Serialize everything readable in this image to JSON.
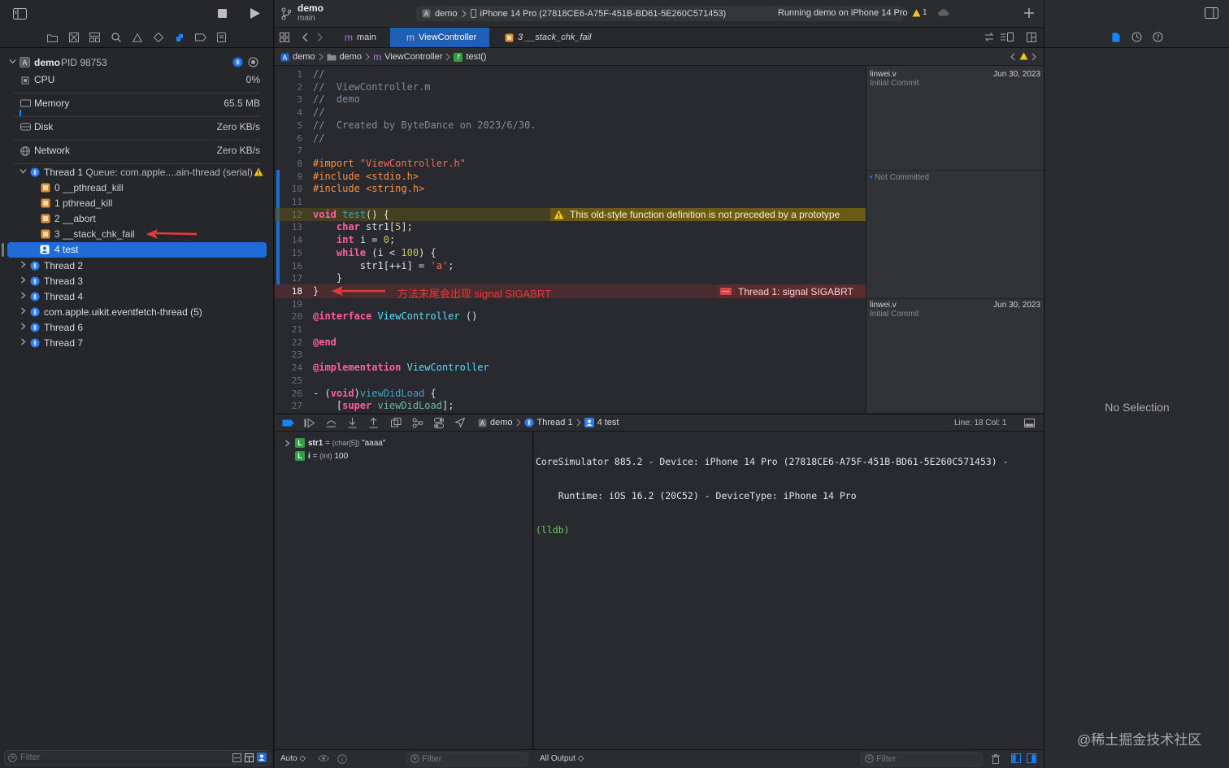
{
  "toolbar": {
    "project": "demo",
    "branch": "main",
    "scheme": "demo",
    "destination": "iPhone 14 Pro (27818CE6-A75F-451B-BD61-5E260C571453)",
    "status": "Running demo on iPhone 14 Pro",
    "warning_count": "1"
  },
  "navigator": {
    "process": {
      "name": "demo",
      "pid": "PID 98753"
    },
    "gauges": [
      {
        "label": "CPU",
        "value": "0%"
      },
      {
        "label": "Memory",
        "value": "65.5 MB"
      },
      {
        "label": "Disk",
        "value": "Zero KB/s"
      },
      {
        "label": "Network",
        "value": "Zero KB/s"
      }
    ],
    "thread1": {
      "label": "Thread 1",
      "queue": "Queue: com.apple....ain-thread (serial)"
    },
    "frames": [
      "0 __pthread_kill",
      "1 pthread_kill",
      "2 __abort",
      "3 __stack_chk_fail",
      "4 test"
    ],
    "threads": [
      "Thread 2",
      "Thread 3",
      "Thread 4",
      "com.apple.uikit.eventfetch-thread (5)",
      "Thread 6",
      "Thread 7"
    ],
    "filter_placeholder": "Filter"
  },
  "tabs": [
    {
      "prefix": "m",
      "label": "main"
    },
    {
      "prefix": "m",
      "label": "ViewController"
    },
    {
      "prefix": "",
      "label": "3 __stack_chk_fail"
    }
  ],
  "jumpbar": [
    "demo",
    "demo",
    "ViewController",
    "test()"
  ],
  "jumpbar_prefix": "m",
  "jumpbar_func_badge": "f",
  "editor": {
    "lines": [
      {
        "n": "1",
        "html": "<span class='cm'>//</span>"
      },
      {
        "n": "2",
        "html": "<span class='cm'>//  ViewController.m</span>"
      },
      {
        "n": "3",
        "html": "<span class='cm'>//  demo</span>"
      },
      {
        "n": "4",
        "html": "<span class='cm'>//</span>"
      },
      {
        "n": "5",
        "html": "<span class='cm'>//  Created by ByteDance on 2023/6/30.</span>"
      },
      {
        "n": "6",
        "html": "<span class='cm'>//</span>"
      },
      {
        "n": "7",
        "html": ""
      },
      {
        "n": "8",
        "html": "<span class='pp'>#import </span><span class='str'>\"ViewController.h\"</span>"
      },
      {
        "n": "9",
        "html": "<span class='pp'>#include &lt;stdio.h&gt;</span>"
      },
      {
        "n": "10",
        "html": "<span class='pp'>#include &lt;string.h&gt;</span>"
      },
      {
        "n": "11",
        "html": ""
      },
      {
        "n": "12",
        "html": "<span class='kw'>void</span> <span class='fnname'>test</span>() {"
      },
      {
        "n": "13",
        "html": "    <span class='kw'>char</span> str1[<span class='num'>5</span>];"
      },
      {
        "n": "14",
        "html": "    <span class='kw'>int</span> i = <span class='num'>0</span>;"
      },
      {
        "n": "15",
        "html": "    <span class='kw'>while</span> (i &lt; <span class='num'>100</span>) {"
      },
      {
        "n": "16",
        "html": "        str1[++i] = <span class='str'>'a'</span>;"
      },
      {
        "n": "17",
        "html": "    }"
      },
      {
        "n": "18",
        "html": "}"
      },
      {
        "n": "19",
        "html": ""
      },
      {
        "n": "20",
        "html": "<span class='kw'>@interface</span> <span class='cls'>ViewController</span> ()"
      },
      {
        "n": "21",
        "html": ""
      },
      {
        "n": "22",
        "html": "<span class='kw'>@end</span>"
      },
      {
        "n": "23",
        "html": ""
      },
      {
        "n": "24",
        "html": "<span class='kw'>@implementation</span> <span class='cls'>ViewController</span>"
      },
      {
        "n": "25",
        "html": ""
      },
      {
        "n": "26",
        "html": "- (<span class='kw'>void</span>)<span class='fnname'>viewDidLoad</span> {"
      },
      {
        "n": "27",
        "html": "    [<span class='kw'>super</span> <span class='fn'>viewDidLoad</span>];"
      }
    ],
    "warning": "This old-style function definition is not preceded by a prototype",
    "signal": "Thread 1: signal SIGABRT",
    "annotation": "方法末尾会出现 signal SIGABRT"
  },
  "blame": [
    {
      "author": "linwei.v",
      "msg": "Initial Commit",
      "date": "Jun 30, 2023"
    },
    {
      "author": "",
      "msg": "Not Committed",
      "date": ""
    },
    {
      "author": "linwei.v",
      "msg": "Initial Commit",
      "date": "Jun 30, 2023"
    }
  ],
  "debugbar": {
    "crumbs": [
      "demo",
      "Thread 1",
      "4 test"
    ],
    "position": "Line: 18  Col: 1"
  },
  "variables": [
    {
      "badge": "L",
      "name": "str1",
      "type": "(char[5])",
      "value": "\"aaaa\""
    },
    {
      "badge": "L",
      "name": "i",
      "type": "(int)",
      "value": "100"
    }
  ],
  "console_lines": [
    "CoreSimulator 885.2 - Device: iPhone 14 Pro (27818CE6-A75F-451B-BD61-5E260C571453) -",
    "    Runtime: iOS 16.2 (20C52) - DeviceType: iPhone 14 Pro"
  ],
  "console_prompt": "(lldb)",
  "bottombar": {
    "auto": "Auto ◇",
    "filter": "Filter",
    "output": "All Output ◇",
    "filter2": "Filter"
  },
  "inspector": {
    "empty": "No Selection"
  },
  "watermark": "@稀土掘金技术社区"
}
